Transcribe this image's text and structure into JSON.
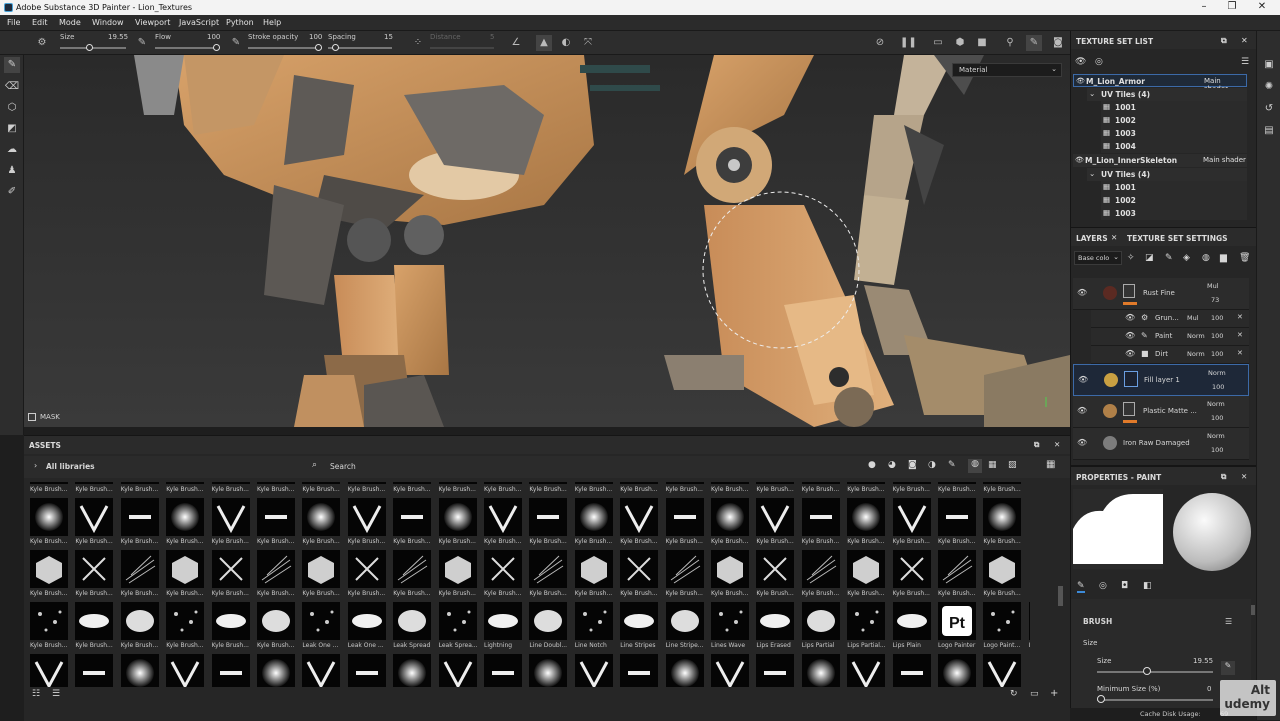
{
  "window": {
    "title": "Adobe Substance 3D Painter - Lion_Textures"
  },
  "menu": [
    "File",
    "Edit",
    "Mode",
    "Window",
    "Viewport",
    "JavaScript",
    "Python",
    "Help"
  ],
  "toolbar": {
    "size_label": "Size",
    "size_value": "19.55",
    "flow_label": "Flow",
    "flow_value": "100",
    "stroke_opacity_label": "Stroke opacity",
    "stroke_opacity_value": "100",
    "spacing_label": "Spacing",
    "spacing_value": "15",
    "distance_label": "Distance",
    "distance_value": "5"
  },
  "viewport": {
    "mask_label": "MASK",
    "channel_select": "Material"
  },
  "texture_set_list": {
    "title": "TEXTURE SET LIST",
    "sets": [
      {
        "name": "M_Lion_Armor",
        "shader": "Main shader",
        "uv_label": "UV Tiles (4)",
        "tiles": [
          "1001",
          "1002",
          "1003",
          "1004"
        ]
      },
      {
        "name": "M_Lion_InnerSkeleton",
        "shader": "Main shader",
        "uv_label": "UV Tiles (4)",
        "tiles": [
          "1001",
          "1002",
          "1003"
        ]
      }
    ]
  },
  "layers": {
    "tab_layers": "LAYERS",
    "tab_settings": "TEXTURE SET SETTINGS",
    "channel": "Base colo",
    "items": [
      {
        "name": "Rust Fine",
        "blend": "Mul",
        "opacity": "73"
      },
      {
        "name": "Grun...",
        "blend": "Mul",
        "opacity": "100"
      },
      {
        "name": "Paint",
        "blend": "Norm",
        "opacity": "100"
      },
      {
        "name": "Dirt",
        "blend": "Norm",
        "opacity": "100"
      },
      {
        "name": "Fill layer 1",
        "blend": "Norm",
        "opacity": "100"
      },
      {
        "name": "Plastic Matte ...",
        "blend": "Norm",
        "opacity": "100"
      },
      {
        "name": "Iron Raw Damaged",
        "blend": "Norm",
        "opacity": "100"
      }
    ]
  },
  "properties": {
    "title": "PROPERTIES - PAINT",
    "brush_section": "BRUSH",
    "size_group": "Size",
    "size_label": "Size",
    "size_value": "19.55",
    "min_size_label": "Minimum Size (%)",
    "min_size_value": "0"
  },
  "assets": {
    "title": "ASSETS",
    "libraries": "All libraries",
    "search_placeholder": "Search",
    "rows": [
      [
        "Kyle Brush...",
        "Kyle Brush...",
        "Kyle Brush...",
        "Kyle Brush...",
        "Kyle Brush...",
        "Kyle Brush...",
        "Kyle Brush...",
        "Kyle Brush...",
        "Kyle Brush...",
        "Kyle Brush...",
        "Kyle Brush...",
        "Kyle Brush...",
        "Kyle Brush...",
        "Kyle Brush...",
        "Kyle Brush...",
        "Kyle Brush...",
        "Kyle Brush...",
        "Kyle Brush...",
        "Kyle Brush...",
        "Kyle Brush...",
        "Kyle Brush...",
        "Kyle Brush..."
      ],
      [
        "Kyle Brush...",
        "Kyle Brush...",
        "Kyle Brush...",
        "Kyle Brush...",
        "Kyle Brush...",
        "Kyle Brush...",
        "Kyle Brush...",
        "Kyle Brush...",
        "Kyle Brush...",
        "Kyle Brush...",
        "Kyle Brush...",
        "Kyle Brush...",
        "Kyle Brush...",
        "Kyle Brush...",
        "Kyle Brush...",
        "Kyle Brush...",
        "Kyle Brush...",
        "Kyle Brush...",
        "Kyle Brush...",
        "Kyle Brush...",
        "Kyle Brush...",
        "Kyle Brush..."
      ],
      [
        "Kyle Brush...",
        "Kyle Brush...",
        "Kyle Brush...",
        "Kyle Brush...",
        "Kyle Brush...",
        "Kyle Brush...",
        "Kyle Brush...",
        "Kyle Brush...",
        "Kyle Brush...",
        "Kyle Brush...",
        "Kyle Brush...",
        "Kyle Brush...",
        "Kyle Brush...",
        "Kyle Brush...",
        "Kyle Brush...",
        "Kyle Brush...",
        "Kyle Brush...",
        "Kyle Brush...",
        "Kyle Brush...",
        "Kyle Brush...",
        "Kyle Brush...",
        "Kyle Brush..."
      ],
      [
        "Kyle Brush...",
        "Kyle Brush...",
        "Kyle Brush...",
        "Kyle Brush...",
        "Kyle Brush...",
        "Kyle Brush...",
        "Leak One ...",
        "Leak One ...",
        "Leak Spread",
        "Leak Sprea...",
        "Lightning",
        "Line Doubl...",
        "Line Notch",
        "Line Stripes",
        "Line Stripe...",
        "Lines Wave",
        "Lips Erased",
        "Lips Partial",
        "Lips Partial...",
        "Lips Plain",
        "Logo Painter",
        "Logo Paint...",
        "Logo Subs..."
      ],
      [
        "",
        "",
        "",
        "",
        "",
        "",
        "",
        "",
        "",
        "",
        "",
        "",
        "",
        "",
        "",
        "",
        "",
        "",
        "",
        "",
        "",
        ""
      ]
    ],
    "pt_logo": "Pt"
  },
  "status": {
    "cache": "Cache Disk Usage:",
    "cache_value": "69"
  },
  "watermark": "Alt udemy"
}
